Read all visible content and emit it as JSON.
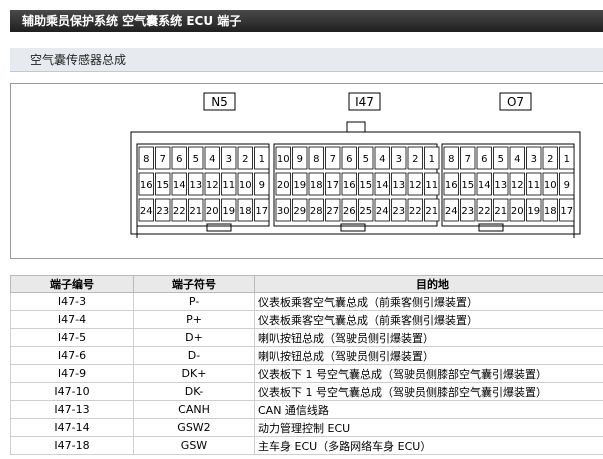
{
  "header": {
    "title": "辅助乘员保护系统  空气囊系统  ECU 端子"
  },
  "section": {
    "title": "空气囊传感器总成"
  },
  "connector": {
    "labels": [
      "N5",
      "I47",
      "O7"
    ],
    "left_rows": [
      [
        "8",
        "7",
        "6",
        "5",
        "4",
        "3",
        "2",
        "1"
      ],
      [
        "16",
        "15",
        "14",
        "13",
        "12",
        "11",
        "10",
        "9"
      ],
      [
        "24",
        "23",
        "22",
        "21",
        "20",
        "19",
        "18",
        "17"
      ]
    ],
    "center_rows": [
      [
        "10",
        "9",
        "8",
        "7",
        "6",
        "5",
        "4",
        "3",
        "2",
        "1"
      ],
      [
        "20",
        "19",
        "18",
        "17",
        "16",
        "15",
        "14",
        "13",
        "12",
        "11"
      ],
      [
        "30",
        "29",
        "28",
        "27",
        "26",
        "25",
        "24",
        "23",
        "22",
        "21"
      ]
    ],
    "right_rows": [
      [
        "8",
        "7",
        "6",
        "5",
        "4",
        "3",
        "2",
        "1"
      ],
      [
        "16",
        "15",
        "14",
        "13",
        "12",
        "11",
        "10",
        "9"
      ],
      [
        "24",
        "23",
        "22",
        "21",
        "20",
        "19",
        "18",
        "17"
      ]
    ]
  },
  "table": {
    "headers": [
      "端子编号",
      "端子符号",
      "目的地"
    ],
    "rows": [
      [
        "I47-3",
        "P-",
        "仪表板乘客空气囊总成（前乘客侧引爆装置）"
      ],
      [
        "I47-4",
        "P+",
        "仪表板乘客空气囊总成（前乘客侧引爆装置）"
      ],
      [
        "I47-5",
        "D+",
        "喇叭按钮总成（驾驶员侧引爆装置）"
      ],
      [
        "I47-6",
        "D-",
        "喇叭按钮总成（驾驶员侧引爆装置）"
      ],
      [
        "I47-9",
        "DK+",
        "仪表板下 1 号空气囊总成（驾驶员侧膝部空气囊引爆装置）"
      ],
      [
        "I47-10",
        "DK-",
        "仪表板下 1 号空气囊总成（驾驶员侧膝部空气囊引爆装置）"
      ],
      [
        "I47-13",
        "CANH",
        "CAN 通信线路"
      ],
      [
        "I47-14",
        "GSW2",
        "动力管理控制 ECU"
      ],
      [
        "I47-18",
        "GSW",
        "主车身 ECU（多路网络车身 ECU）"
      ]
    ]
  }
}
